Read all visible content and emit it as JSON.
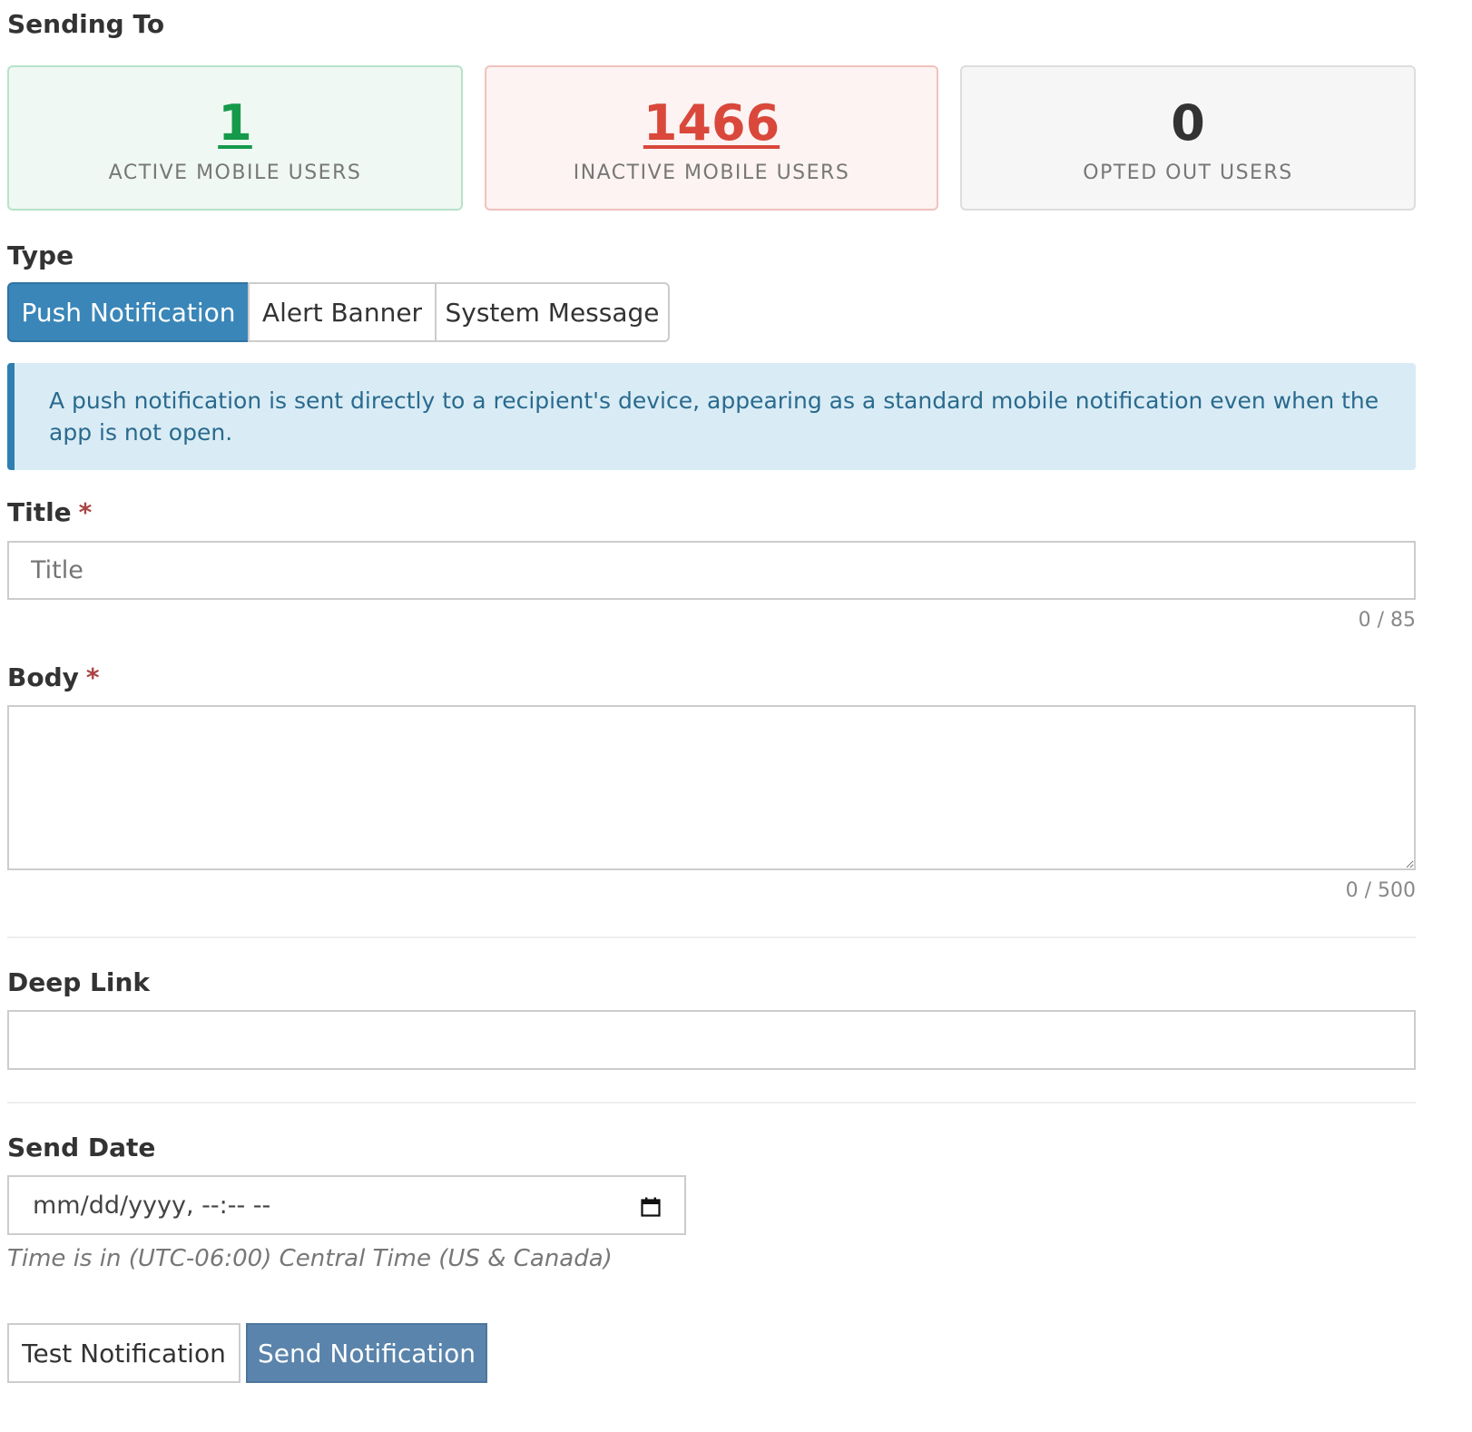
{
  "sending_to": {
    "label": "Sending To",
    "active": {
      "count": "1",
      "caption": "ACTIVE MOBILE USERS"
    },
    "inactive": {
      "count": "1466",
      "caption": "INACTIVE MOBILE USERS"
    },
    "opted_out": {
      "count": "0",
      "caption": "OPTED OUT USERS"
    }
  },
  "type": {
    "label": "Type",
    "options": [
      "Push Notification",
      "Alert Banner",
      "System Message"
    ],
    "selected": "Push Notification"
  },
  "info_text": "A push notification is sent directly to a recipient's device, appearing as a standard mobile notification even when the app is not open.",
  "title_field": {
    "label": "Title",
    "required_mark": "*",
    "placeholder": "Title",
    "value": "",
    "counter": "0 / 85"
  },
  "body_field": {
    "label": "Body",
    "required_mark": "*",
    "value": "",
    "counter": "0 / 500"
  },
  "deep_link": {
    "label": "Deep Link",
    "value": ""
  },
  "send_date": {
    "label": "Send Date",
    "placeholder": "mm/dd/yyyy, --:-- --",
    "timezone_note": "Time is in (UTC-06:00) Central Time (US & Canada)"
  },
  "actions": {
    "test_label": "Test Notification",
    "send_label": "Send Notification"
  },
  "colors": {
    "active": "#159a4b",
    "inactive": "#d9483b",
    "primary": "#3a86b8",
    "info_bg": "#d9ecf5"
  }
}
